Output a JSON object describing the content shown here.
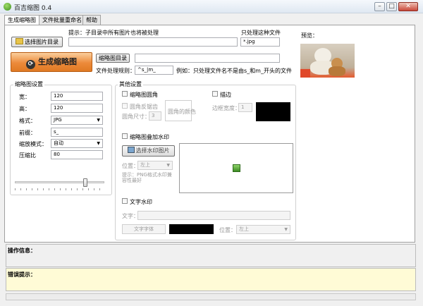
{
  "window": {
    "title": "百吉缩图 0.4",
    "min_glyph": "–",
    "max_glyph": "□",
    "close_glyph": "✕"
  },
  "tabs": [
    "生成缩略图",
    "文件批量重命名",
    "帮助"
  ],
  "top": {
    "hint": "提示：子目录中所有图片也将被处理",
    "select_dir_button": "选择图片目录",
    "process_label": "只处理这种文件",
    "process_value": "*.jpg",
    "preview_label": "预览：",
    "generate_button": "生成缩略图",
    "thumb_dir_button": "缩略图目录",
    "thumb_dir_value": "",
    "rule_label": "文件处理规则：",
    "rule_value": "^s_|m_",
    "rule_example": "例如：只处理文件名不是由s_和m_开头的文件"
  },
  "thumb_settings": {
    "title": "缩略图设置",
    "width_label": "宽：",
    "width_value": "120",
    "height_label": "高：",
    "height_value": "120",
    "format_label": "格式：",
    "format_value": "JPG",
    "prefix_label": "前缀：",
    "prefix_value": "s_",
    "scale_label": "缩放模式：",
    "scale_value": "自动",
    "compress_label": "压缩比",
    "compress_value": "80",
    "slider_value": 80
  },
  "other_settings": {
    "title": "其他设置",
    "rounded_label": "缩略图圆角",
    "antialias_label": "圆角反锯齿",
    "corner_size_label": "圆角尺寸：",
    "corner_size_value": "3",
    "corner_color_label": "圆角的颜色",
    "border_label": "描边",
    "border_width_label": "边框宽度：",
    "border_width_value": "1",
    "watermark_label": "缩略图叠加水印",
    "select_watermark_button": "选择水印图片",
    "position_label": "位置：",
    "position_value": "左上",
    "watermark_hint": "提示：PNG格式水印兼容性最好",
    "text_watermark_label": "文字水印",
    "text_label": "文字：",
    "text_value": "",
    "font_button": "文字字体",
    "text_position_label": "位置：",
    "text_position_value": "左上"
  },
  "status": {
    "operation_label": "操作信息：",
    "error_label": "错误提示："
  },
  "colors": {
    "accent_orange": "#ec8a3a",
    "error_bg": "#fffbd6"
  }
}
